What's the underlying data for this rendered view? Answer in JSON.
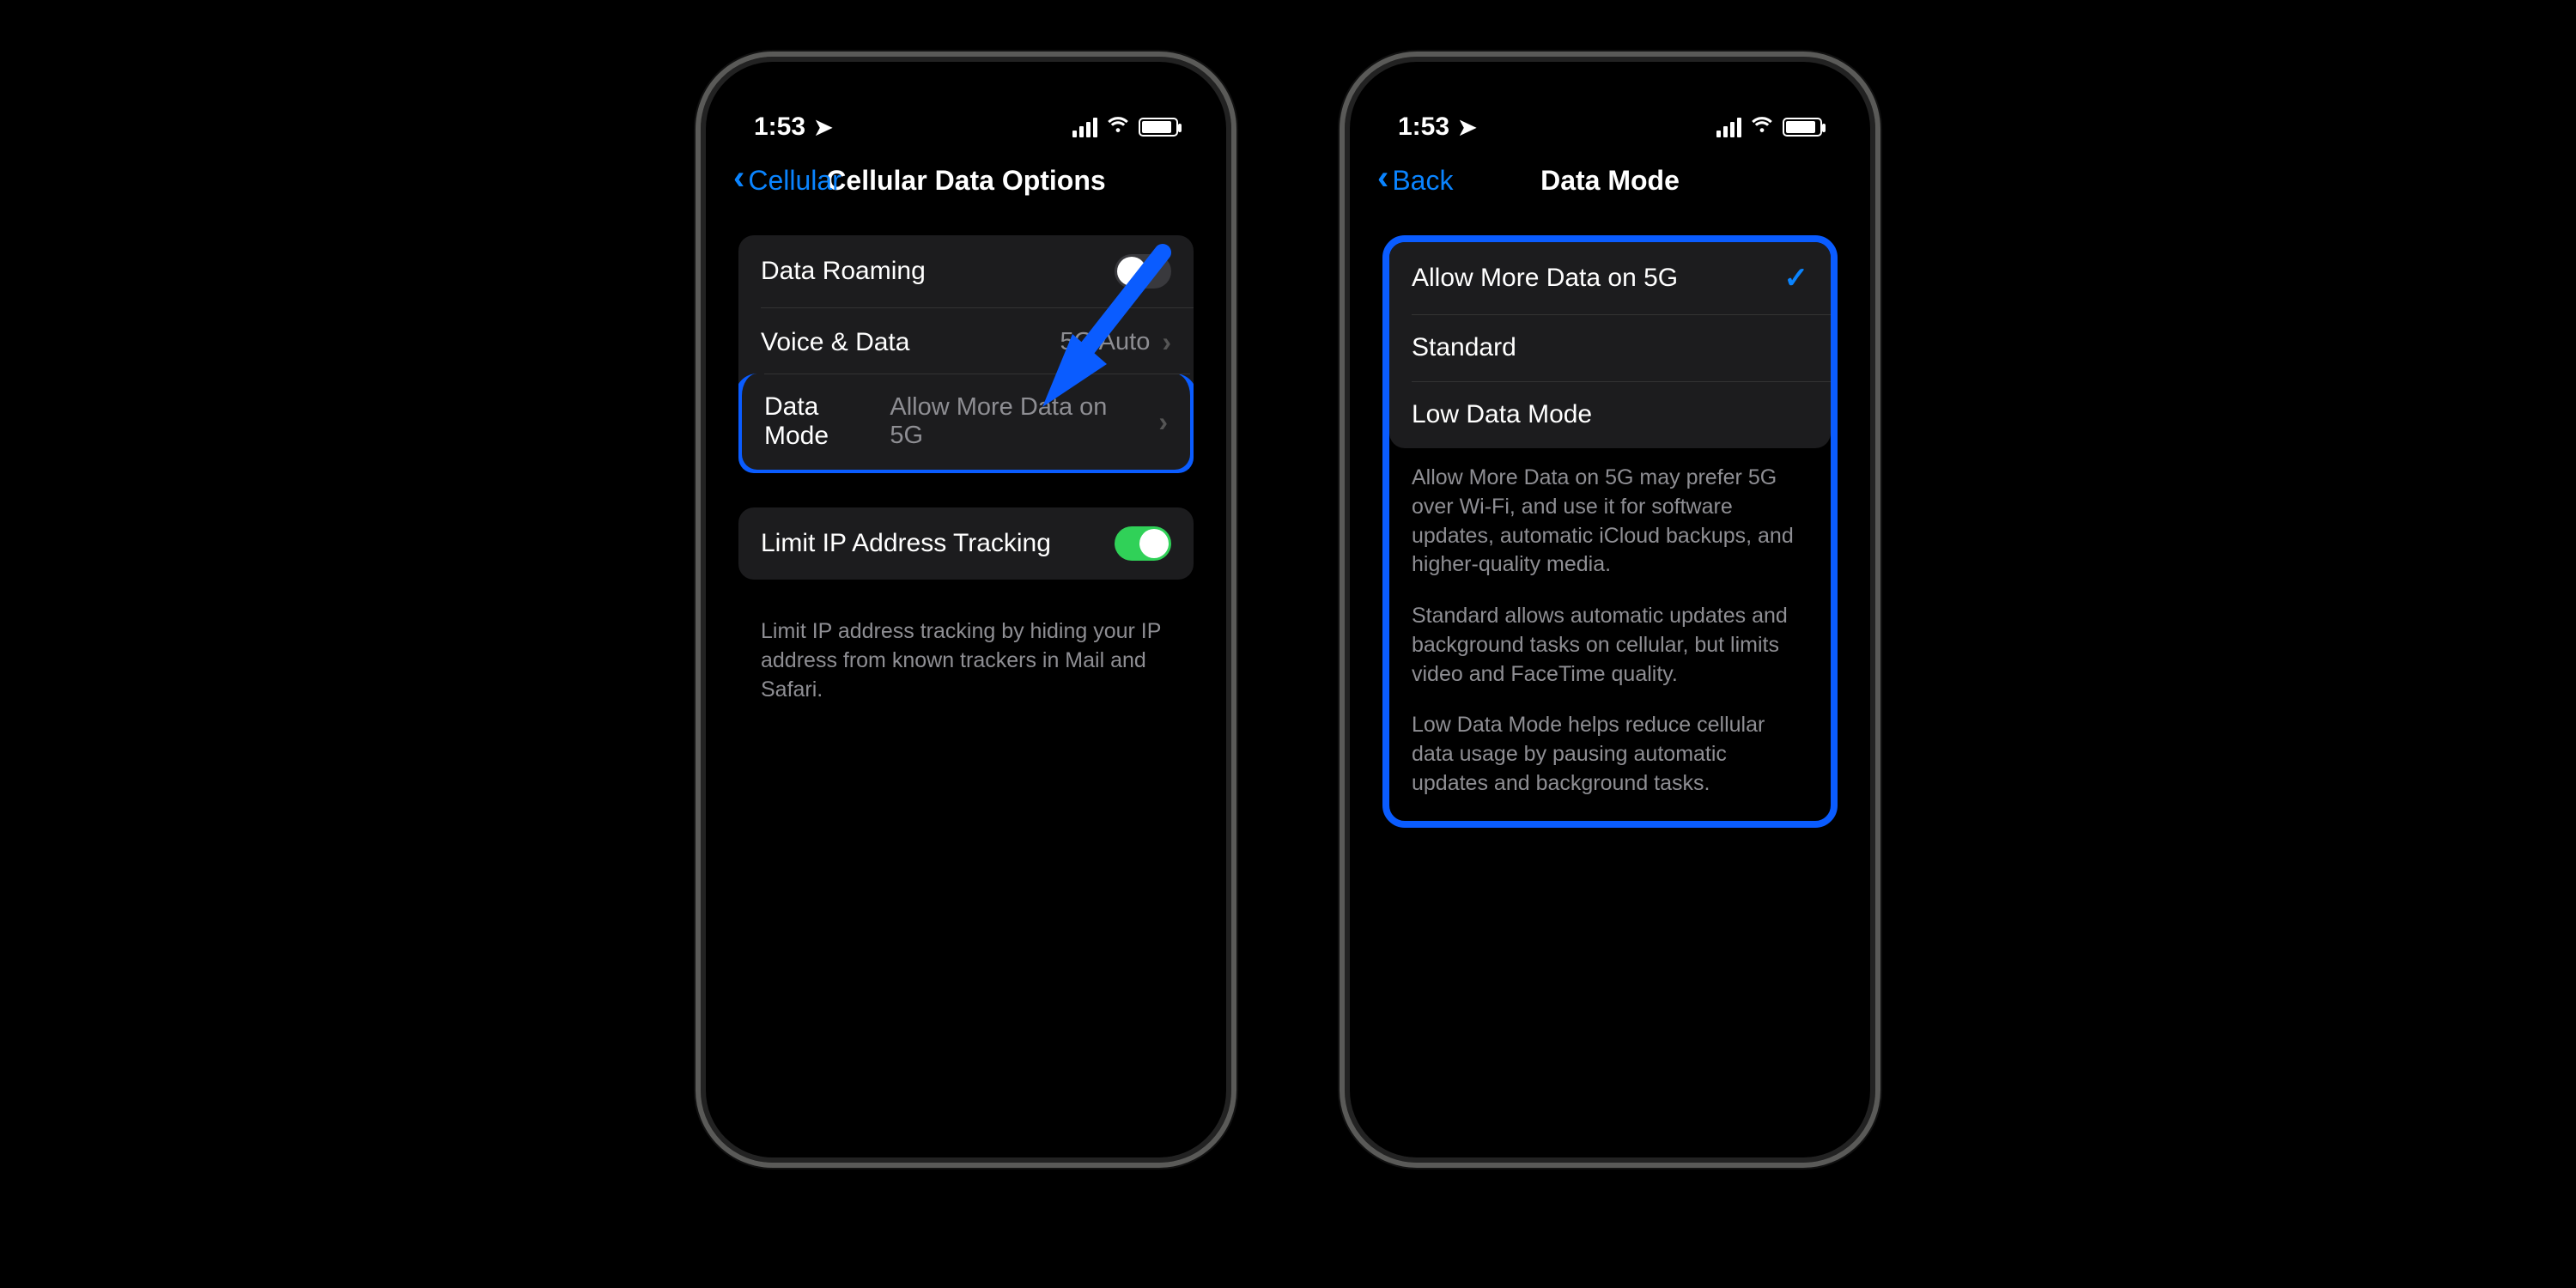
{
  "status": {
    "time": "1:53"
  },
  "left": {
    "nav": {
      "back": "Cellular",
      "title": "Cellular Data Options"
    },
    "rows": {
      "roaming": "Data Roaming",
      "voice": "Voice & Data",
      "voice_value": "5G Auto",
      "mode": "Data Mode",
      "mode_value": "Allow More Data on 5G",
      "limit": "Limit IP Address Tracking"
    },
    "foot": "Limit IP address tracking by hiding your IP address from known trackers in Mail and Safari."
  },
  "right": {
    "nav": {
      "back": "Back",
      "title": "Data Mode"
    },
    "options": {
      "opt1": "Allow More Data on 5G",
      "opt2": "Standard",
      "opt3": "Low Data Mode"
    },
    "foot1": "Allow More Data on 5G may prefer 5G over Wi-Fi, and use it for software updates, automatic iCloud backups, and higher-quality media.",
    "foot2": "Standard allows automatic updates and background tasks on cellular, but limits video and FaceTime quality.",
    "foot3": "Low Data Mode helps reduce cellular data usage by pausing automatic updates and background tasks."
  }
}
